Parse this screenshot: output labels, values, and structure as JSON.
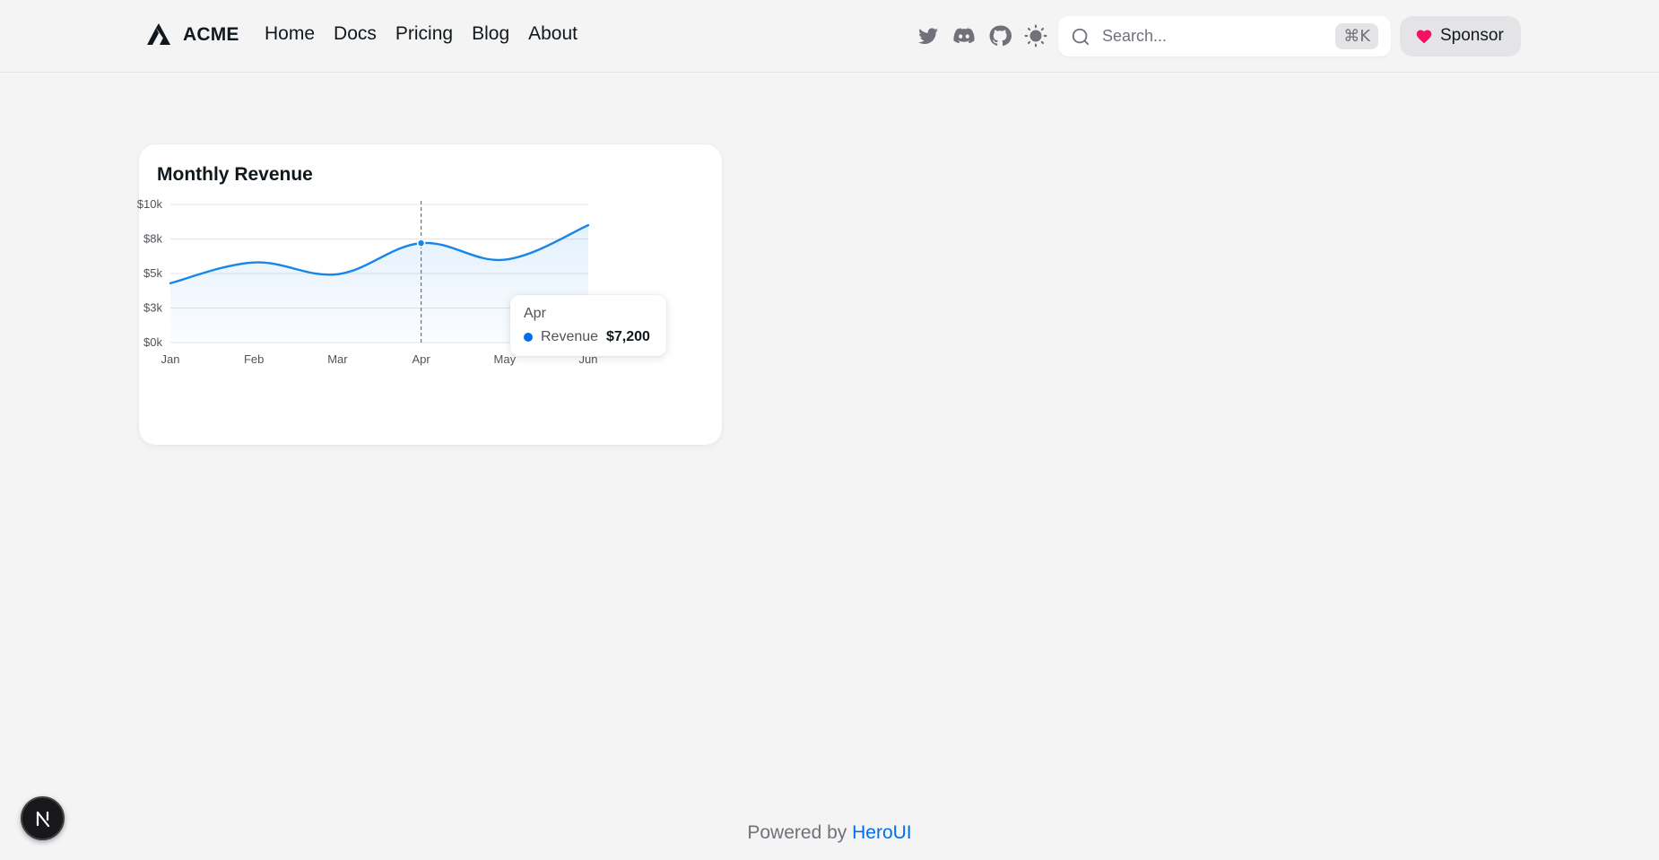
{
  "navbar": {
    "brand": "ACME",
    "links": [
      "Home",
      "Docs",
      "Pricing",
      "Blog",
      "About"
    ],
    "icons": [
      "twitter-icon",
      "discord-icon",
      "github-icon",
      "theme-toggle-icon"
    ],
    "search": {
      "placeholder": "Search...",
      "shortcut": "⌘K"
    },
    "sponsor_label": "Sponsor"
  },
  "card": {
    "title": "Monthly Revenue"
  },
  "chart_data": {
    "type": "area",
    "title": "Monthly Revenue",
    "categories": [
      "Jan",
      "Feb",
      "Mar",
      "Apr",
      "May",
      "Jun"
    ],
    "series": [
      {
        "name": "Revenue",
        "values": [
          4300,
          5800,
          4950,
          7200,
          6000,
          8500
        ]
      }
    ],
    "ylim": [
      0,
      10000
    ],
    "yticks": [
      0,
      2500,
      5000,
      7500,
      10000
    ],
    "ytick_labels": [
      "$0k",
      "$3k",
      "$5k",
      "$8k",
      "$10k"
    ],
    "grid": true,
    "active_index": 3,
    "tooltip": {
      "label": "Apr",
      "series": "Revenue",
      "value": "$7,200"
    }
  },
  "colors": {
    "accent": "#006fee",
    "line": "#1886e8",
    "heart": "#f31260"
  },
  "footer": {
    "prefix": "Powered by",
    "link": "HeroUI"
  },
  "badge": {
    "letter": "N"
  }
}
